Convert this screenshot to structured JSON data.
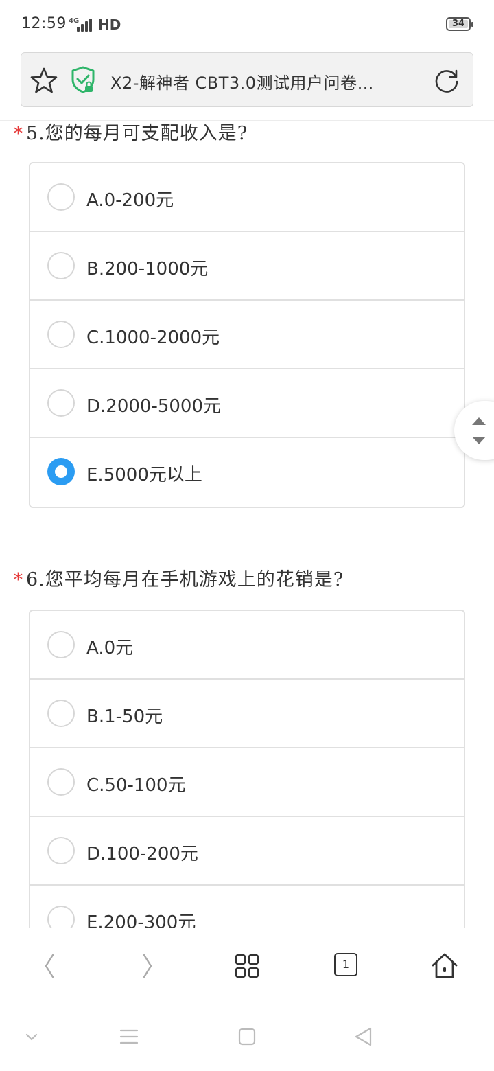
{
  "status_bar": {
    "time": "12:59",
    "network": "4G",
    "hd": "HD",
    "battery": "34"
  },
  "address_bar": {
    "title": "X2-解神者 CBT3.0测试用户问卷…"
  },
  "questions": [
    {
      "required_mark": "*",
      "title": "5.您的每月可支配收入是?",
      "options": [
        {
          "label": "A.0-200元",
          "selected": false
        },
        {
          "label": "B.200-1000元",
          "selected": false
        },
        {
          "label": "C.1000-2000元",
          "selected": false
        },
        {
          "label": "D.2000-5000元",
          "selected": false
        },
        {
          "label": "E.5000元以上",
          "selected": true
        }
      ]
    },
    {
      "required_mark": "*",
      "title": "6.您平均每月在手机游戏上的花销是?",
      "options": [
        {
          "label": "A.0元",
          "selected": false
        },
        {
          "label": "B.1-50元",
          "selected": false
        },
        {
          "label": "C.50-100元",
          "selected": false
        },
        {
          "label": "D.100-200元",
          "selected": false
        },
        {
          "label": "E.200-300元",
          "selected": false
        }
      ]
    }
  ],
  "toolbar": {
    "tab_count": "1"
  },
  "colors": {
    "accent": "#2b9cf2",
    "required": "#e63a3a",
    "shield": "#2fb56a"
  }
}
